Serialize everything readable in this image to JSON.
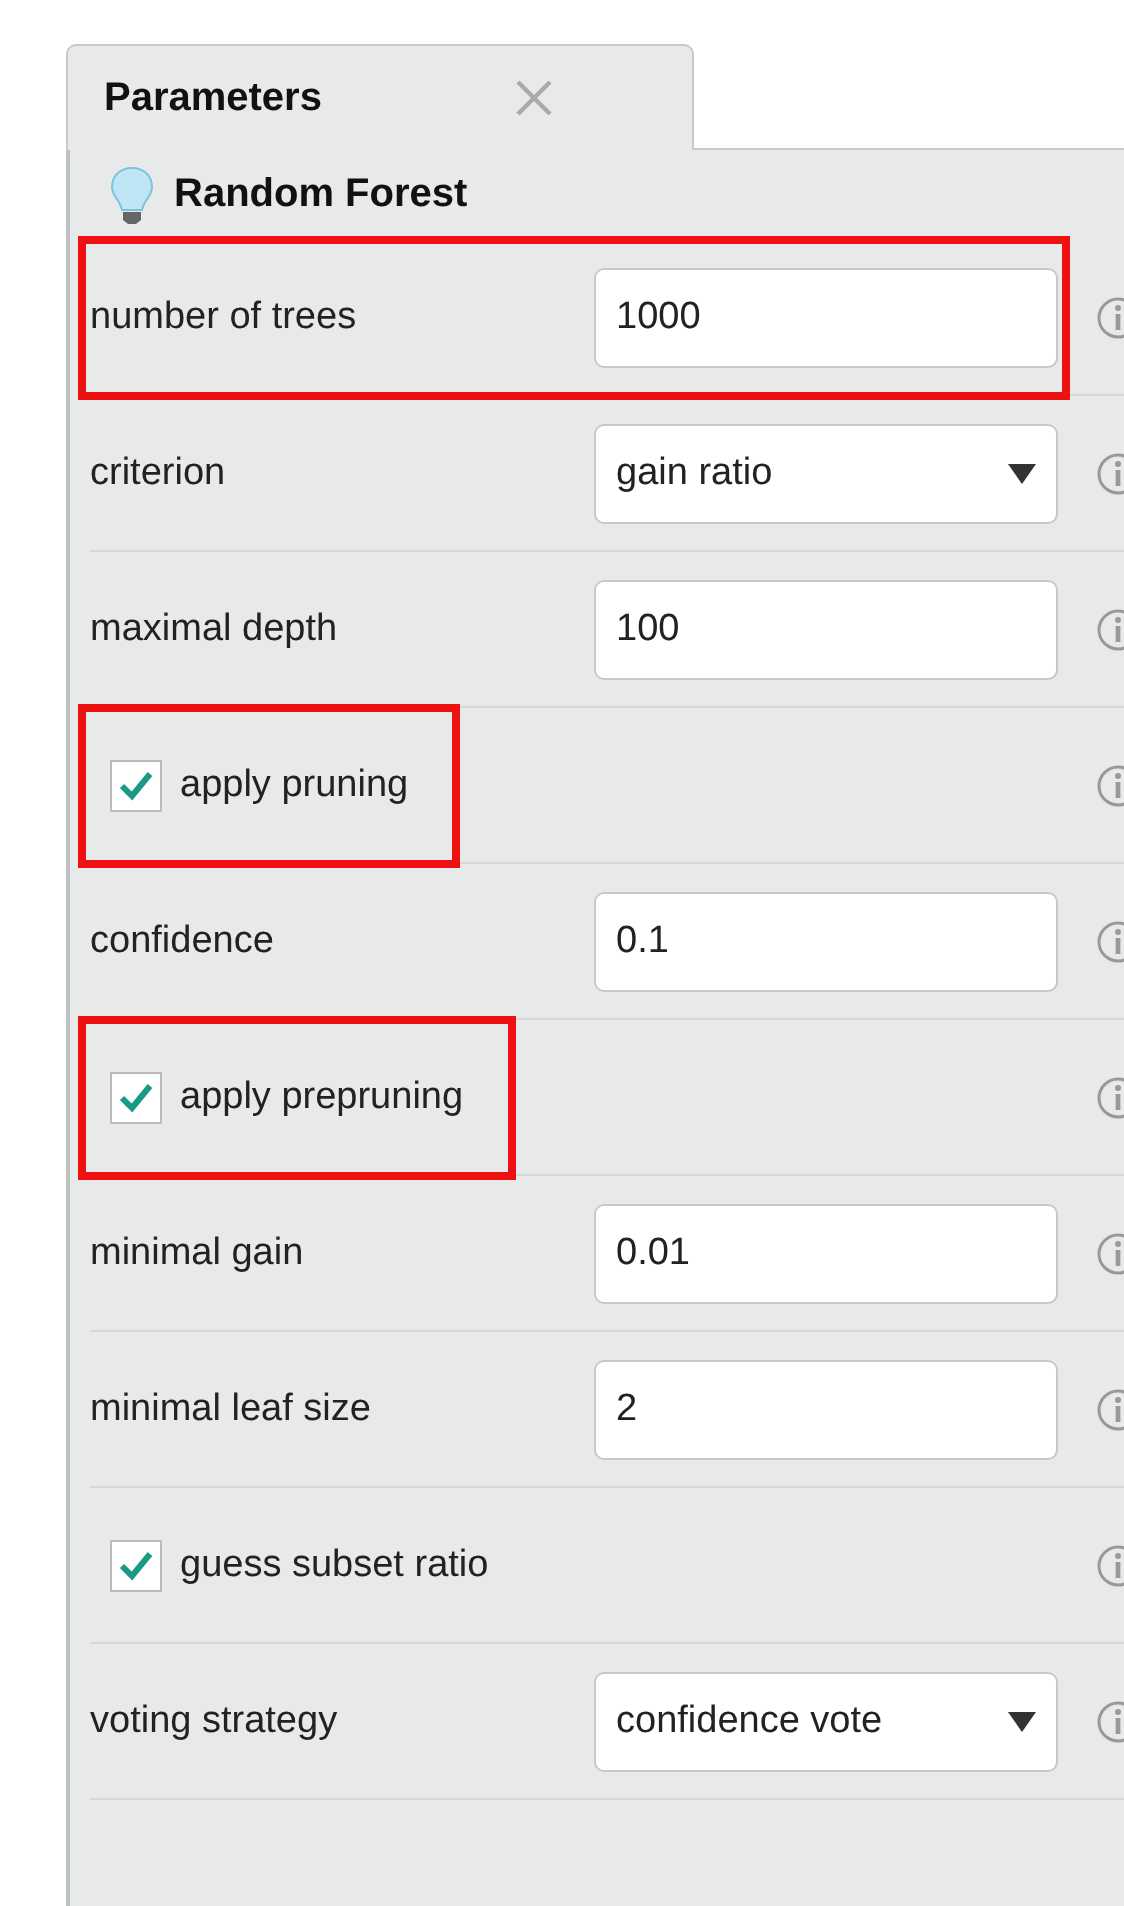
{
  "tab": {
    "title": "Parameters",
    "selected": true
  },
  "operator": {
    "name": "Random Forest"
  },
  "parameters": [
    {
      "kind": "number",
      "label": "number of trees",
      "value": "1000",
      "highlighted": true
    },
    {
      "kind": "select",
      "label": "criterion",
      "value": "gain ratio",
      "highlighted": false
    },
    {
      "kind": "number",
      "label": "maximal depth",
      "value": "100",
      "highlighted": false
    },
    {
      "kind": "checkbox",
      "label": "apply pruning",
      "checked": true,
      "highlighted": true
    },
    {
      "kind": "number",
      "label": "confidence",
      "value": "0.1",
      "highlighted": false
    },
    {
      "kind": "checkbox",
      "label": "apply prepruning",
      "checked": true,
      "highlighted": true
    },
    {
      "kind": "number",
      "label": "minimal gain",
      "value": "0.01",
      "highlighted": false
    },
    {
      "kind": "number",
      "label": "minimal leaf size",
      "value": "2",
      "highlighted": false
    },
    {
      "kind": "checkbox",
      "label": "guess subset ratio",
      "checked": true,
      "highlighted": false
    },
    {
      "kind": "select",
      "label": "voting strategy",
      "value": "confidence vote",
      "highlighted": false
    }
  ]
}
